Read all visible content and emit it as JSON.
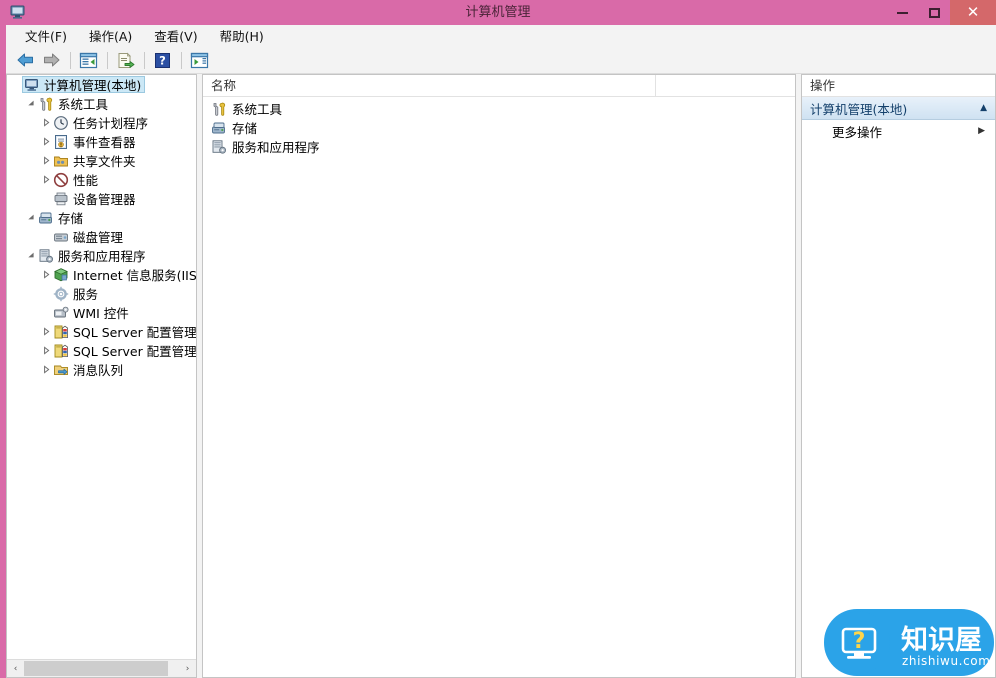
{
  "window": {
    "title": "计算机管理",
    "icon": "computer-management-icon",
    "controls": {
      "minimize": "–",
      "maximize": "□",
      "close": "✕"
    },
    "titlebar_color": "#d96aa8",
    "close_button_color": "#d4686a"
  },
  "menubar": {
    "items": [
      {
        "label": "文件(F)",
        "name": "menu-file"
      },
      {
        "label": "操作(A)",
        "name": "menu-action"
      },
      {
        "label": "查看(V)",
        "name": "menu-view"
      },
      {
        "label": "帮助(H)",
        "name": "menu-help"
      }
    ]
  },
  "toolbar": {
    "buttons": [
      {
        "name": "back-button",
        "icon": "back-arrow-icon"
      },
      {
        "name": "forward-button",
        "icon": "forward-arrow-icon"
      },
      {
        "name": "show-hide-tree-button",
        "icon": "console-tree-icon"
      },
      {
        "name": "export-list-button",
        "icon": "export-list-icon"
      },
      {
        "name": "help-button",
        "icon": "help-question-icon"
      },
      {
        "name": "show-hide-action-pane-button",
        "icon": "action-pane-icon"
      }
    ]
  },
  "tree": {
    "items": [
      {
        "label": "计算机管理(本地)",
        "indent": 0,
        "twisty": "none",
        "icon": "computer-icon",
        "selected": true
      },
      {
        "label": "系统工具",
        "indent": 1,
        "twisty": "expanded",
        "icon": "system-tools-icon",
        "selected": false
      },
      {
        "label": "任务计划程序",
        "indent": 2,
        "twisty": "collapsed",
        "icon": "task-scheduler-clock-icon",
        "selected": false
      },
      {
        "label": "事件查看器",
        "indent": 2,
        "twisty": "collapsed",
        "icon": "event-viewer-icon",
        "selected": false
      },
      {
        "label": "共享文件夹",
        "indent": 2,
        "twisty": "collapsed",
        "icon": "shared-folders-icon",
        "selected": false
      },
      {
        "label": "性能",
        "indent": 2,
        "twisty": "collapsed",
        "icon": "performance-icon",
        "selected": false
      },
      {
        "label": "设备管理器",
        "indent": 2,
        "twisty": "none",
        "icon": "device-manager-icon",
        "selected": false
      },
      {
        "label": "存储",
        "indent": 1,
        "twisty": "expanded",
        "icon": "storage-icon",
        "selected": false
      },
      {
        "label": "磁盘管理",
        "indent": 2,
        "twisty": "none",
        "icon": "disk-management-icon",
        "selected": false
      },
      {
        "label": "服务和应用程序",
        "indent": 1,
        "twisty": "expanded",
        "icon": "services-apps-icon",
        "selected": false
      },
      {
        "label": "Internet 信息服务(IIS)管理器",
        "indent": 2,
        "twisty": "collapsed",
        "icon": "iis-manager-icon",
        "selected": false
      },
      {
        "label": "服务",
        "indent": 2,
        "twisty": "none",
        "icon": "services-gear-icon",
        "selected": false
      },
      {
        "label": "WMI 控件",
        "indent": 2,
        "twisty": "none",
        "icon": "wmi-control-icon",
        "selected": false
      },
      {
        "label": "SQL Server 配置管理器",
        "indent": 2,
        "twisty": "collapsed",
        "icon": "sql-server-config-icon",
        "selected": false
      },
      {
        "label": "SQL Server 配置管理器",
        "indent": 2,
        "twisty": "collapsed",
        "icon": "sql-server-config-icon",
        "selected": false
      },
      {
        "label": "消息队列",
        "indent": 2,
        "twisty": "collapsed",
        "icon": "message-queue-icon",
        "selected": false
      }
    ],
    "hscroll": {
      "left_arrow": "‹",
      "right_arrow": "›"
    }
  },
  "list": {
    "columns": [
      {
        "label": "名称",
        "name": "column-name"
      },
      {
        "label": "",
        "name": "column-blank"
      }
    ],
    "rows": [
      {
        "label": "系统工具",
        "icon": "system-tools-icon"
      },
      {
        "label": "存储",
        "icon": "storage-icon"
      },
      {
        "label": "服务和应用程序",
        "icon": "services-apps-icon"
      }
    ]
  },
  "actions": {
    "title": "操作",
    "group_header": "计算机管理(本地)",
    "group_collapse_glyph": "▲",
    "items": [
      {
        "label": "更多操作",
        "arrow": "▶"
      }
    ]
  },
  "watermark": {
    "brand": "知识屋",
    "domain": "zhishiwu.com",
    "color": "#2ba3e8"
  }
}
